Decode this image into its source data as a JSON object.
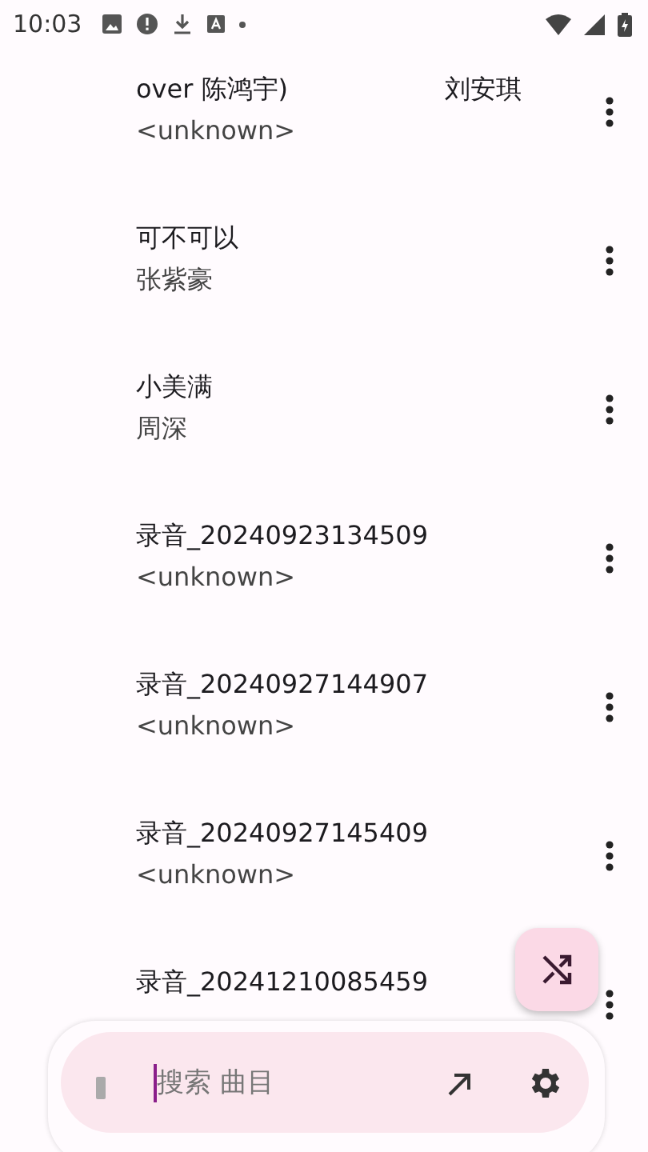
{
  "status_bar": {
    "time": "10:03"
  },
  "songs": [
    {
      "title": "over 陈鸿宇)",
      "title_next": "刘安琪",
      "artist": "<unknown>"
    },
    {
      "title": "可不可以",
      "artist": "张紫豪"
    },
    {
      "title": "小美满",
      "artist": "周深"
    },
    {
      "title": "录音_20240923134509",
      "artist": "<unknown>"
    },
    {
      "title": "录音_20240927144907",
      "artist": "<unknown>"
    },
    {
      "title": "录音_20240927145409",
      "artist": "<unknown>"
    },
    {
      "title": "录音_20241210085459"
    }
  ],
  "search": {
    "placeholder": "搜索 曲目",
    "focused": true
  }
}
